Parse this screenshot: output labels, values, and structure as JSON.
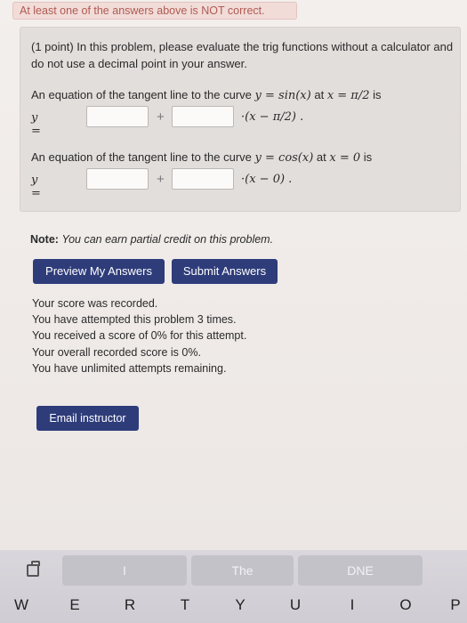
{
  "warning": "At least one of the answers above is NOT correct.",
  "problem": {
    "intro": "(1 point) In this problem, please evaluate the trig functions without a calculator and do not use a decimal point in your answer.",
    "part1": {
      "question_prefix": "An equation of the tangent line to the curve",
      "func": "y = sin(x)",
      "at_word": "at",
      "point": "x = π/2",
      "suffix": "is",
      "label": "y =",
      "plus": "+",
      "tail": "·(x − π/2) ."
    },
    "part2": {
      "question_prefix": "An equation of the tangent line to the curve",
      "func": "y = cos(x)",
      "at_word": "at",
      "point": "x = 0",
      "suffix": "is",
      "label": "y =",
      "plus": "+",
      "tail": "·(x − 0) ."
    }
  },
  "note": {
    "label": "Note:",
    "text": "You can earn partial credit on this problem."
  },
  "buttons": {
    "preview": "Preview My Answers",
    "submit": "Submit Answers",
    "email": "Email instructor"
  },
  "score_lines": [
    "Your score was recorded.",
    "You have attempted this problem 3 times.",
    "You received a score of 0% for this attempt.",
    "Your overall recorded score is 0%.",
    "You have unlimited attempts remaining."
  ],
  "keyboard": {
    "suggestions": [
      "I",
      "The",
      "DNE"
    ],
    "keys": [
      "W",
      "E",
      "R",
      "T",
      "Y",
      "U",
      "I",
      "O",
      "P"
    ]
  }
}
